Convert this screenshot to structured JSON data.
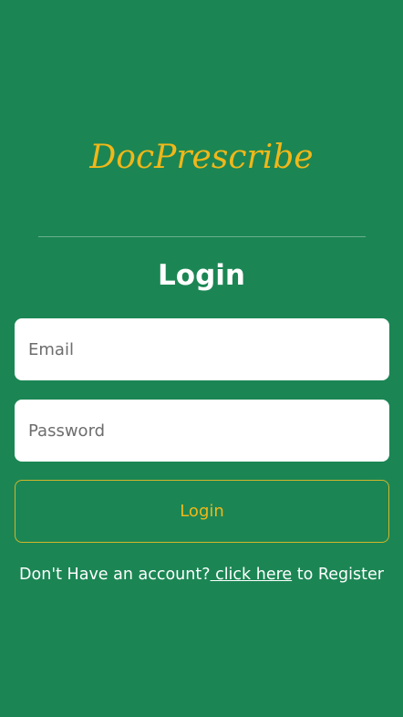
{
  "app": {
    "logo_text": "DocPrescribe"
  },
  "login": {
    "heading": "Login",
    "email_placeholder": "Email",
    "password_placeholder": "Password",
    "button_label": "Login"
  },
  "register": {
    "prefix": "Don't Have an account?",
    "link_label": " click here",
    "suffix": " to Register"
  },
  "colors": {
    "background": "#1b8654",
    "accent": "#f1b719",
    "button_border": "#d1b52b",
    "text": "#ffffff"
  }
}
